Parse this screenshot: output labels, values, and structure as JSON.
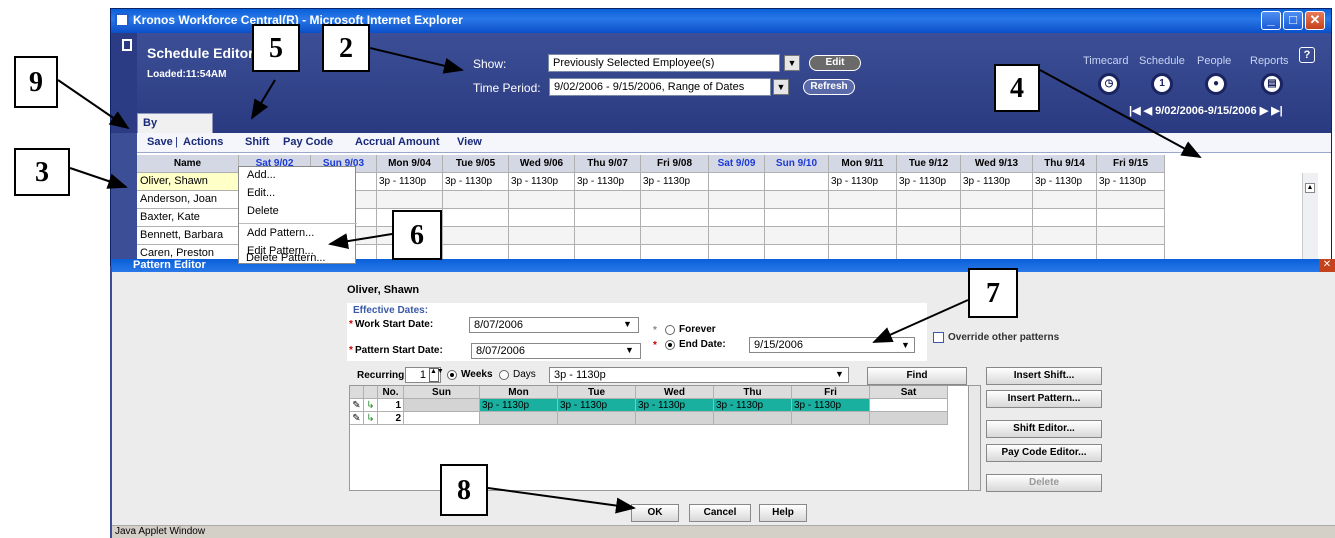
{
  "window": {
    "title": "Kronos Workforce Central(R) - Microsoft Internet Explorer",
    "min": "_",
    "max": "□",
    "close": "✕"
  },
  "header": {
    "title": "Schedule Editor",
    "loaded": "Loaded:11:54AM",
    "show_label": "Show:",
    "show_value": "Previously Selected Employee(s)",
    "edit_label": "Edit",
    "period_label": "Time Period:",
    "period_value": "9/02/2006 - 9/15/2006, Range of Dates",
    "refresh_label": "Refresh",
    "nav": [
      "Timecard",
      "Schedule",
      "People",
      "Reports"
    ],
    "help": "?",
    "range": "|◀  ◀  9/02/2006-9/15/2006  ▶  ▶|"
  },
  "tab": "By Employee",
  "menu": {
    "save": "Save",
    "sep": "|",
    "actions": "Actions",
    "shift": "Shift",
    "paycode": "Pay Code",
    "accrual": "Accrual Amount",
    "view": "View"
  },
  "grid": {
    "headers": [
      "Name",
      "Sat 9/02",
      "Sun 9/03",
      "Mon 9/04",
      "Tue 9/05",
      "Wed 9/06",
      "Thu 9/07",
      "Fri 9/08",
      "Sat 9/09",
      "Sun 9/10",
      "Mon 9/11",
      "Tue 9/12",
      "Wed 9/13",
      "Thu 9/14",
      "Fri 9/15"
    ],
    "rows": [
      {
        "name": "Oliver, Shawn",
        "cells": [
          "",
          "",
          "3p - 1130p",
          "3p - 1130p",
          "3p - 1130p",
          "3p - 1130p",
          "3p - 1130p",
          "",
          "",
          "3p - 1130p",
          "3p - 1130p",
          "3p - 1130p",
          "3p - 1130p",
          "3p - 1130p"
        ]
      },
      {
        "name": "Anderson, Joan",
        "cells": [
          "",
          "",
          "",
          "",
          "",
          "",
          "",
          "",
          "",
          "",
          "",
          "",
          "",
          ""
        ]
      },
      {
        "name": "Baxter, Kate",
        "cells": [
          "",
          "",
          "",
          "",
          "",
          "",
          "",
          "",
          "",
          "",
          "",
          "",
          "",
          ""
        ]
      },
      {
        "name": "Bennett, Barbara",
        "cells": [
          "",
          "",
          "",
          "",
          "",
          "",
          "",
          "",
          "",
          "",
          "",
          "",
          "",
          ""
        ]
      },
      {
        "name": "Caren, Preston",
        "cells": [
          "",
          "",
          "",
          "",
          "",
          "",
          "",
          "",
          "",
          "",
          "",
          "",
          "",
          ""
        ]
      }
    ]
  },
  "shift_menu": [
    "Add...",
    "Edit...",
    "Delete",
    "Add Pattern...",
    "Edit Pattern...",
    "Delete Pattern..."
  ],
  "pattern": {
    "title": "Pattern Editor",
    "employee": "Oliver, Shawn",
    "effective": "Effective Dates:",
    "req": "*",
    "work_start_label": "Work Start Date:",
    "work_start": "8/07/2006",
    "pattern_start_label": "Pattern Start Date:",
    "pattern_start": "8/07/2006",
    "forever": "Forever",
    "end_label": "End Date:",
    "end_date": "9/15/2006",
    "override": "Override other patterns",
    "recurring_label": "Recurring:",
    "recurring_value": "1",
    "weeks": "Weeks",
    "days": "Days",
    "shift_select": "3p - 1130p",
    "find": "Find",
    "columns": [
      "",
      "",
      "No.",
      "Sun",
      "Mon",
      "Tue",
      "Wed",
      "Thu",
      "Fri",
      "Sat"
    ],
    "rows": [
      {
        "no": "1",
        "cells": [
          "",
          "3p - 1130p",
          "3p - 1130p",
          "3p - 1130p",
          "3p - 1130p",
          "3p - 1130p",
          ""
        ]
      },
      {
        "no": "2",
        "cells": [
          "",
          "",
          "",
          "",
          "",
          "",
          ""
        ]
      }
    ],
    "buttons": {
      "insert_shift": "Insert Shift...",
      "insert_pattern": "Insert Pattern...",
      "shift_editor": "Shift Editor...",
      "paycode_editor": "Pay Code Editor...",
      "delete": "Delete",
      "ok": "OK",
      "cancel": "Cancel",
      "help": "Help"
    },
    "java": "Java Applet Window"
  },
  "callouts": [
    "9",
    "5",
    "2",
    "4",
    "3",
    "6",
    "7",
    "8"
  ],
  "colors": {
    "header_bg": "#2a3a80",
    "shift_fill": "#19b0a0",
    "selected_row": "#ffffc8",
    "weekend_text": "#1a3ad8"
  }
}
